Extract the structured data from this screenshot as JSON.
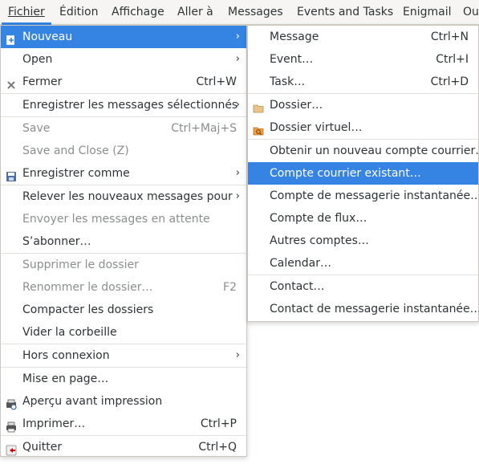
{
  "menubar": {
    "items": [
      {
        "label": "Fichier",
        "mnemonic": "F"
      },
      {
        "label": "Édition"
      },
      {
        "label": "Affichage"
      },
      {
        "label": "Aller à"
      },
      {
        "label": "Messages"
      },
      {
        "label": "Events and Tasks"
      },
      {
        "label": "Enigmail"
      },
      {
        "label": "Ou"
      }
    ]
  },
  "file_menu": {
    "items": [
      {
        "label": "Nouveau",
        "has_submenu": true,
        "highlighted": true,
        "icon": "new-icon"
      },
      {
        "label": "Open",
        "has_submenu": true
      },
      {
        "label": "Fermer",
        "accel": "Ctrl+W",
        "icon": "close-icon"
      },
      {
        "label": "Enregistrer les messages sélectionnés",
        "has_submenu": true
      },
      {
        "label": "Save",
        "accel": "Ctrl+Maj+S",
        "disabled": true
      },
      {
        "label": "Save and Close (Z)",
        "disabled": true
      },
      {
        "label": "Enregistrer comme",
        "has_submenu": true,
        "icon": "save-as-icon"
      },
      {
        "label": "Relever les nouveaux messages pour",
        "has_submenu": true
      },
      {
        "label": "Envoyer les messages en attente",
        "disabled": true
      },
      {
        "label": "S’abonner…"
      },
      {
        "label": "Supprimer le dossier",
        "disabled": true
      },
      {
        "label": "Renommer le dossier…",
        "accel": "F2",
        "disabled": true
      },
      {
        "label": "Compacter les dossiers"
      },
      {
        "label": "Vider la corbeille"
      },
      {
        "label": "Hors connexion",
        "has_submenu": true
      },
      {
        "label": "Mise en page…"
      },
      {
        "label": "Aperçu avant impression",
        "icon": "print-preview-icon"
      },
      {
        "label": "Imprimer…",
        "accel": "Ctrl+P",
        "icon": "printer-icon"
      },
      {
        "label": "Quitter",
        "accel": "Ctrl+Q",
        "icon": "quit-icon"
      }
    ]
  },
  "new_submenu": {
    "items": [
      {
        "label": "Message",
        "accel": "Ctrl+N"
      },
      {
        "label": "Event…",
        "accel": "Ctrl+I"
      },
      {
        "label": "Task…",
        "accel": "Ctrl+D"
      },
      {
        "label": "Dossier…",
        "icon": "folder-icon"
      },
      {
        "label": "Dossier virtuel…",
        "icon": "virtual-folder-icon"
      },
      {
        "label": "Obtenir un nouveau compte courrier…"
      },
      {
        "label": "Compte courrier existant…",
        "highlighted": true
      },
      {
        "label": "Compte de messagerie instantanée…"
      },
      {
        "label": "Compte de flux…"
      },
      {
        "label": "Autres comptes…"
      },
      {
        "label": "Calendar…"
      },
      {
        "label": "Contact…"
      },
      {
        "label": "Contact de messagerie instantanée…"
      }
    ]
  },
  "colors": {
    "highlight": "#3584e4",
    "menu_bg": "#ffffff",
    "menubar_bg": "#f6f5f4",
    "disabled_text": "#8b8e8f"
  }
}
